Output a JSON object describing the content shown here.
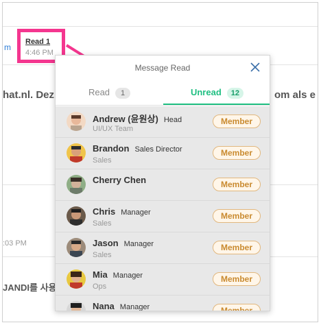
{
  "background": {
    "left_m": "m",
    "fragment": "hat.nl. Dez",
    "right_fragment": "om als e",
    "time": ":03 PM",
    "korean": "JANDI를 사용"
  },
  "highlight": {
    "read_label": "Read 1",
    "time": "4:46 PM"
  },
  "popup": {
    "title": "Message Read",
    "tabs": [
      {
        "label": "Read",
        "count": "1"
      },
      {
        "label": "Unread",
        "count": "12"
      }
    ],
    "members": [
      {
        "name": "Andrew (윤원상)",
        "role": "Head",
        "dept": "UI/UX Team",
        "badge": "Member"
      },
      {
        "name": "Brandon",
        "role": "Sales Director",
        "dept": "Sales",
        "badge": "Member"
      },
      {
        "name": "Cherry Chen",
        "role": "",
        "dept": "",
        "badge": "Member"
      },
      {
        "name": "Chris",
        "role": "Manager",
        "dept": "Sales",
        "badge": "Member"
      },
      {
        "name": "Jason",
        "role": "Manager",
        "dept": "Sales",
        "badge": "Member"
      },
      {
        "name": "Mia",
        "role": "Manager",
        "dept": "Ops",
        "badge": "Member"
      },
      {
        "name": "Nana",
        "role": "Manager",
        "dept": "",
        "badge": "Member"
      }
    ]
  },
  "colors": {
    "accent": "#1fbf82",
    "highlight": "#f4368f",
    "badge_border": "#e1b77e"
  }
}
